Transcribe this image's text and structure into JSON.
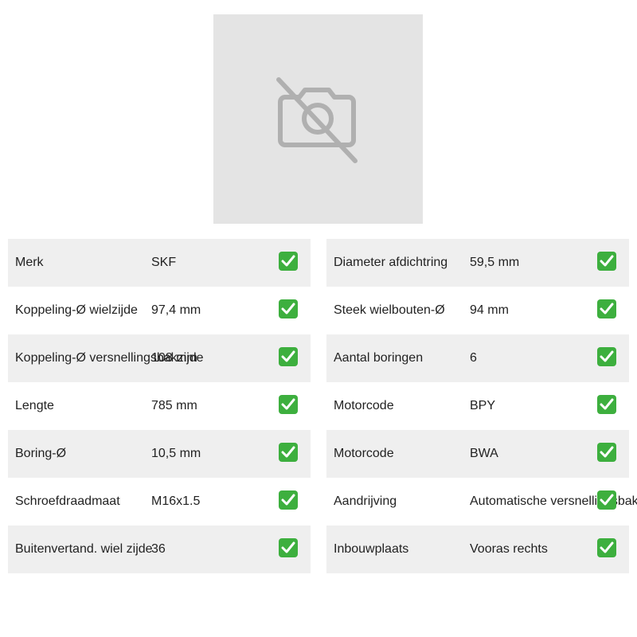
{
  "image": {
    "icon": "no-image-camera-icon"
  },
  "left_table": [
    {
      "label": "Merk",
      "value": "SKF"
    },
    {
      "label": "Koppeling-Ø wielzijde",
      "value": "97,4 mm"
    },
    {
      "label": "Koppeling-Ø versnellingsbakzijde",
      "value": "108 mm"
    },
    {
      "label": "Lengte",
      "value": "785 mm"
    },
    {
      "label": "Boring-Ø",
      "value": "10,5 mm"
    },
    {
      "label": "Schroefdraadmaat",
      "value": "M16x1.5"
    },
    {
      "label": "Buitenvertand. wiel zijde",
      "value": "36"
    }
  ],
  "right_table": [
    {
      "label": "Diameter afdichtring",
      "value": "59,5 mm"
    },
    {
      "label": "Steek wielbouten-Ø",
      "value": "94 mm"
    },
    {
      "label": "Aantal boringen",
      "value": "6"
    },
    {
      "label": "Motorcode",
      "value": "BPY"
    },
    {
      "label": "Motorcode",
      "value": "BWA"
    },
    {
      "label": "Aandrijving",
      "value": "Automatische versnellingsbak"
    },
    {
      "label": "Inbouwplaats",
      "value": "Vooras rechts"
    }
  ],
  "colors": {
    "check": "#3daf3e",
    "row_shade": "#efefef",
    "placeholder": "#e4e4e4"
  }
}
